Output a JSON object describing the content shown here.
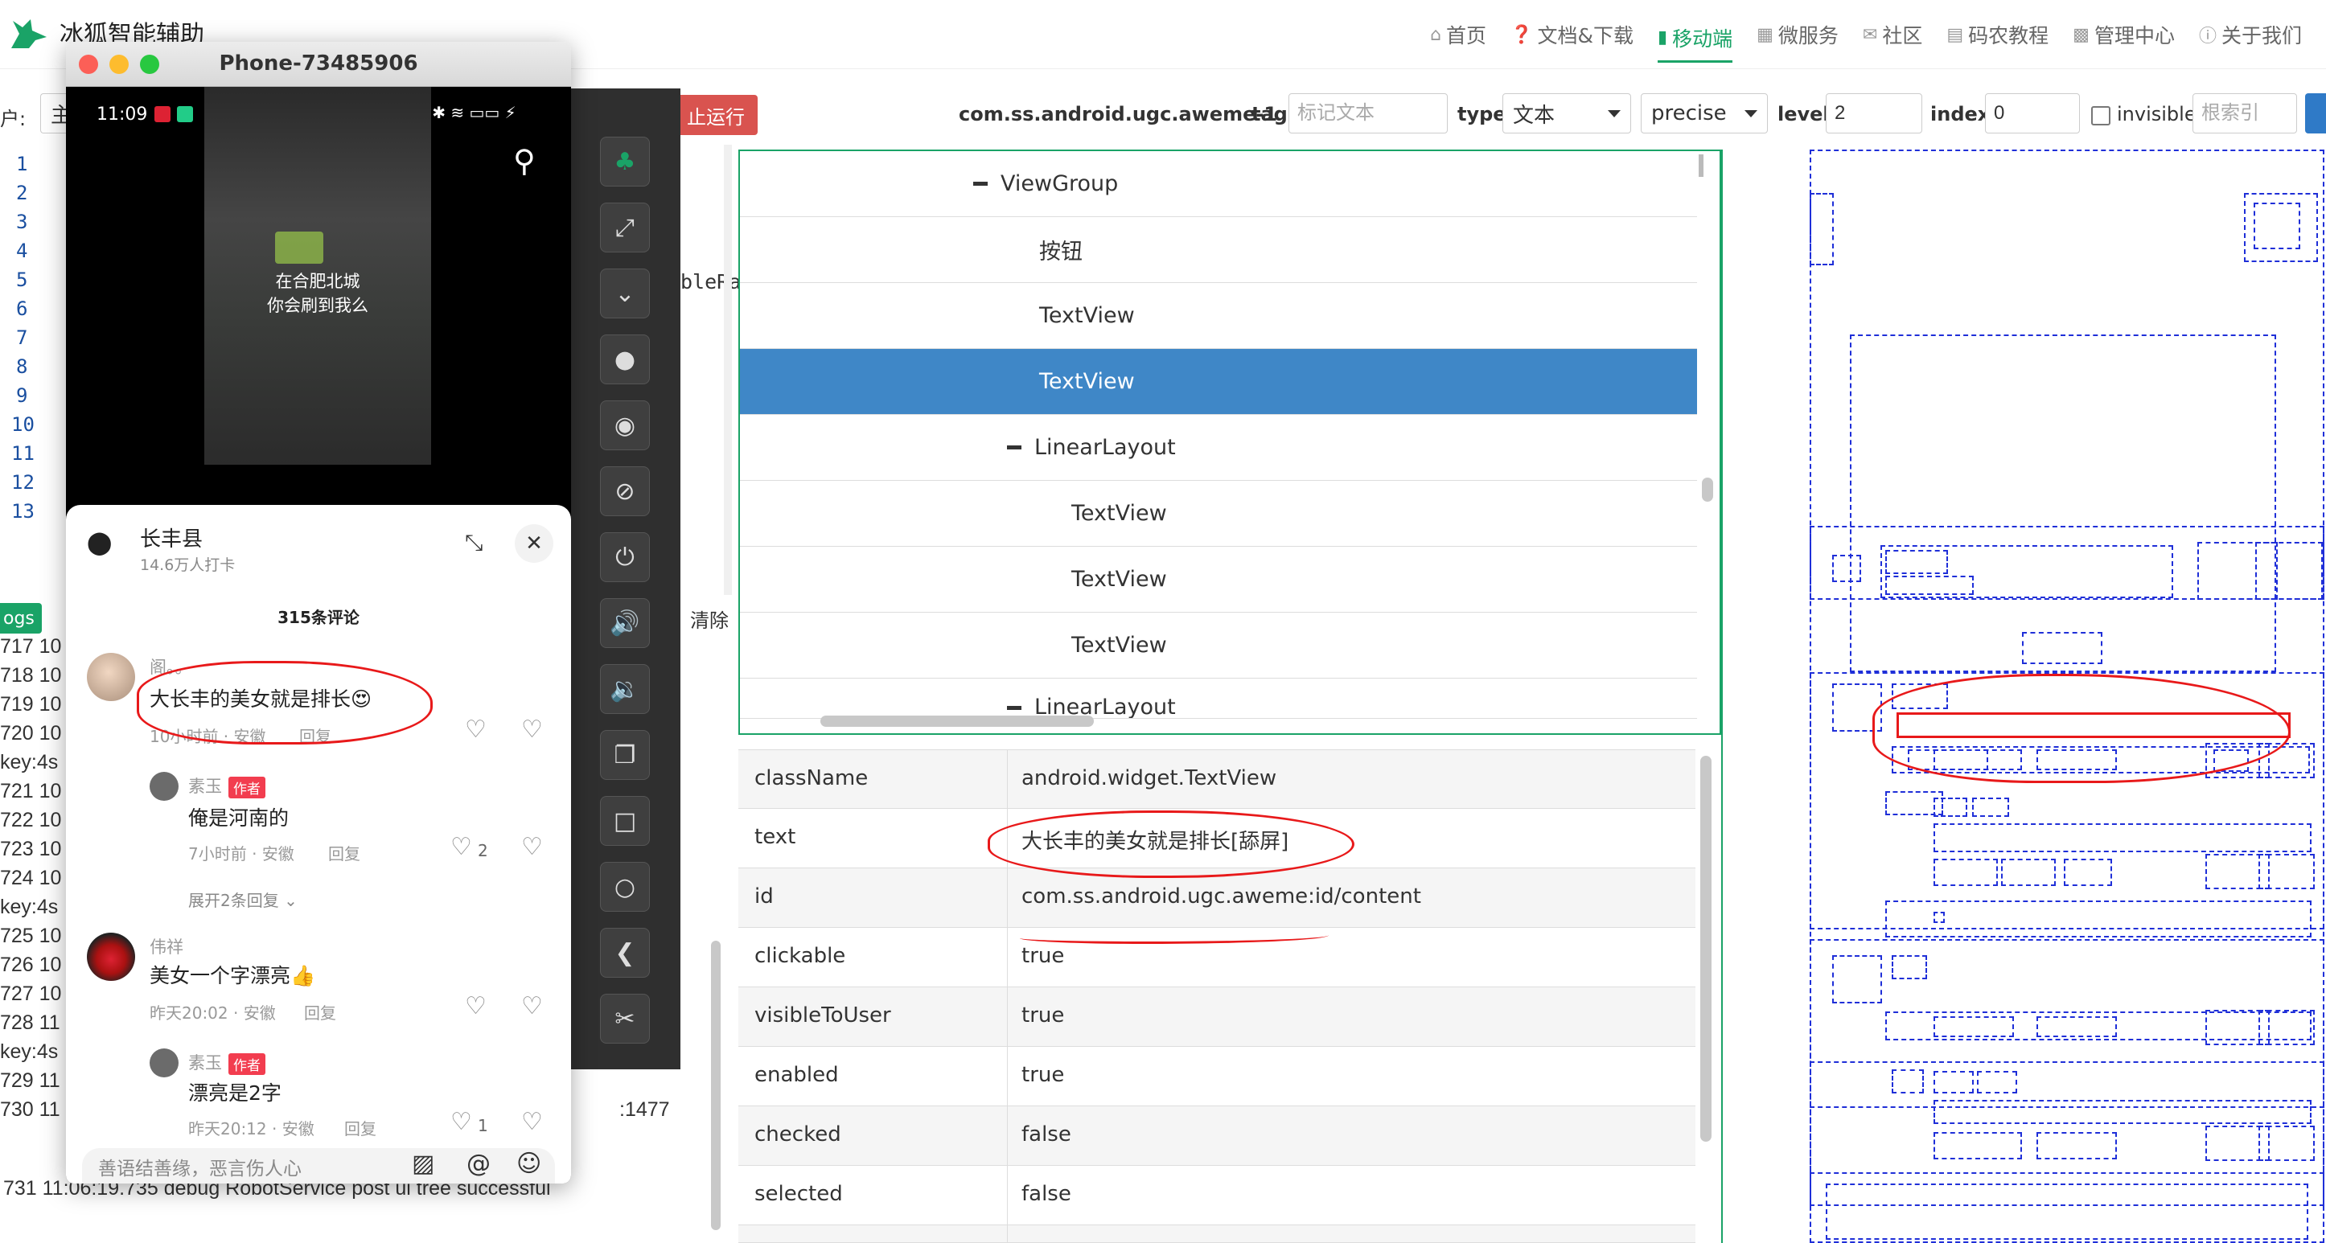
{
  "brand": {
    "title": "冰狐智能辅助"
  },
  "nav": [
    {
      "label": "首页",
      "icon": "home-icon",
      "active": false
    },
    {
      "label": "文档&下载",
      "icon": "question-icon",
      "active": false
    },
    {
      "label": "移动端",
      "icon": "mobile-icon",
      "active": true
    },
    {
      "label": "微服务",
      "icon": "grid-icon",
      "active": false
    },
    {
      "label": "社区",
      "icon": "chat-icon",
      "active": false
    },
    {
      "label": "码农教程",
      "icon": "code-icon",
      "active": false
    },
    {
      "label": "管理中心",
      "icon": "dashboard-icon",
      "active": false
    },
    {
      "label": "关于我们",
      "icon": "info-icon",
      "active": false
    }
  ],
  "toolbar": {
    "user_label": "户:",
    "user_value": "主",
    "stop_label": "止运行",
    "package": "com.ss.android.ugc.aweme-1",
    "tag_label": "tag",
    "tag_placeholder": "标记文本",
    "type_label": "type",
    "type_value": "文本",
    "mode_value": "precise",
    "level_label": "level",
    "level_value": "2",
    "index_label": "index",
    "index_value": "0",
    "invisible_label": "invisible",
    "root_placeholder": "根索引"
  },
  "editor": {
    "line_numbers": [
      "1",
      "2",
      "3",
      "4",
      "5",
      "6",
      "7",
      "8",
      "9",
      "10",
      "11",
      "12",
      "13"
    ],
    "snippet": "bleRa"
  },
  "logs": {
    "tag": "ogs",
    "clear_label": "清除",
    "lines": [
      "717 10",
      "718 10",
      "719 10",
      "720 10",
      "key:4s",
      "721 10",
      "722 10",
      "723 10",
      "724 10",
      "key:4s",
      "725 10",
      "726 10",
      "727 10",
      "728 11",
      "key:4s",
      "729 11",
      "730 11"
    ],
    "tail_right": ":1477",
    "last_line": "731 11:06:19.735 debug RobotService post ui tree successful"
  },
  "phone": {
    "title": "Phone-73485906",
    "time": "11:09",
    "video_caption_1": "在合肥北城",
    "video_caption_2": "你会刷到我么",
    "location_name": "长丰县",
    "location_sub": "14.6万人打卡",
    "comment_count": "315条评论",
    "comments": [
      {
        "name": "阁。。",
        "text": "大长丰的美女就是排长😍",
        "meta": "10小时前 · 安徽",
        "reply": "回复"
      },
      {
        "name": "素玉",
        "badge": "作者",
        "text": "俺是河南的",
        "meta": "7小时前 · 安徽",
        "reply": "回复",
        "likes": "2"
      },
      {
        "expand": "展开2条回复"
      },
      {
        "name": "伟祥",
        "text": "美女一个字漂亮👍",
        "meta": "昨天20:02 · 安徽",
        "reply": "回复"
      },
      {
        "name": "素玉",
        "badge": "作者",
        "text": "漂亮是2字",
        "meta": "昨天20:12 · 安徽",
        "reply": "回复",
        "likes": "1"
      }
    ],
    "input_placeholder": "善语结善缘，恶言伤人心"
  },
  "tree": {
    "rows": [
      {
        "label": "ViewGroup",
        "indent": 2,
        "collapsible": true
      },
      {
        "label": "按钮",
        "indent": 3,
        "collapsible": false
      },
      {
        "label": "TextView",
        "indent": 3,
        "collapsible": false
      },
      {
        "label": "TextView",
        "indent": 3,
        "collapsible": false,
        "selected": true
      },
      {
        "label": "LinearLayout",
        "indent": 3,
        "collapsible": true
      },
      {
        "label": "TextView",
        "indent": 4,
        "collapsible": false
      },
      {
        "label": "TextView",
        "indent": 4,
        "collapsible": false
      },
      {
        "label": "TextView",
        "indent": 4,
        "collapsible": false
      },
      {
        "label": "LinearLayout",
        "indent": 3,
        "collapsible": true
      }
    ]
  },
  "properties": [
    {
      "key": "className",
      "value": "android.widget.TextView"
    },
    {
      "key": "text",
      "value": "大长丰的美女就是排长[舔屏]"
    },
    {
      "key": "id",
      "value": "com.ss.android.ugc.aweme:id/content"
    },
    {
      "key": "clickable",
      "value": "true"
    },
    {
      "key": "visibleToUser",
      "value": "true"
    },
    {
      "key": "enabled",
      "value": "true"
    },
    {
      "key": "checked",
      "value": "false"
    },
    {
      "key": "selected",
      "value": "false"
    }
  ],
  "colors": {
    "accent": "#1aa367",
    "selected_row": "#3f87c7",
    "stop": "#d9534f",
    "annotation": "#e8191a",
    "layout_box": "#1f2fd8"
  }
}
